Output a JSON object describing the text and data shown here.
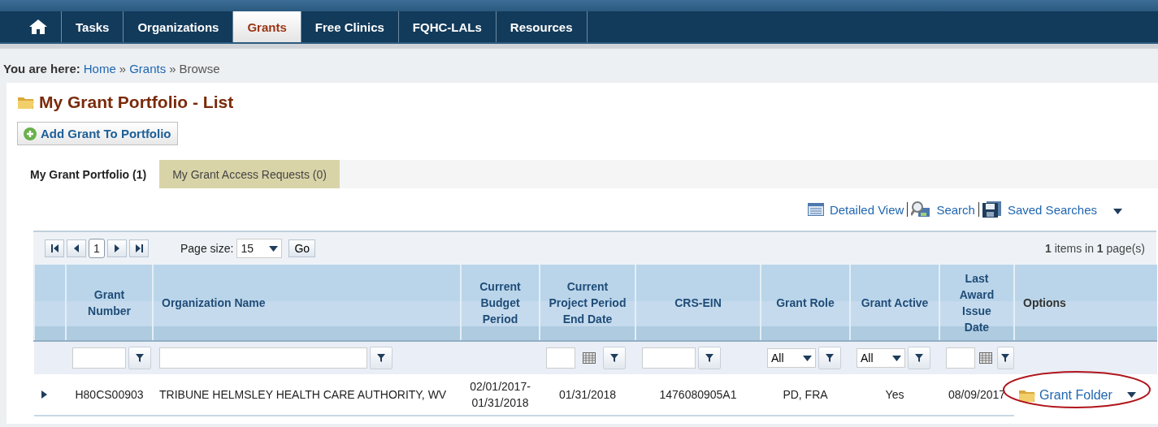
{
  "nav": [
    {
      "kind": "home",
      "selected": false
    },
    {
      "kind": "text",
      "label": "Tasks",
      "selected": false
    },
    {
      "kind": "text",
      "label": "Organizations",
      "selected": false
    },
    {
      "kind": "text",
      "label": "Grants",
      "selected": true
    },
    {
      "kind": "text",
      "label": "Free Clinics",
      "selected": false
    },
    {
      "kind": "text",
      "label": "FQHC-LALs",
      "selected": false
    },
    {
      "kind": "text",
      "label": "Resources",
      "selected": false
    }
  ],
  "breadcrumb": {
    "label": "You are here:",
    "links": [
      "Home",
      "Grants"
    ],
    "separators": [
      "»",
      "»"
    ],
    "current": "Browse"
  },
  "page_title": "My Grant Portfolio - List",
  "add_button": "Add Grant To Portfolio",
  "tabs": [
    {
      "label": "My Grant Portfolio (1)",
      "selected": true
    },
    {
      "label": "My Grant Access Requests (0)",
      "selected": false
    }
  ],
  "view_links": [
    {
      "kind": "list",
      "label": "Detailed View"
    },
    {
      "kind": "search",
      "label": "Search"
    },
    {
      "kind": "save",
      "label": "Saved Searches"
    }
  ],
  "pager": {
    "page": "1",
    "page_size_label": "Page size:",
    "page_size": "15",
    "go": "Go",
    "summary": "**1** items in **1** page(s)"
  },
  "columns": [
    {
      "filter": {
        "kind": "none"
      }
    },
    {
      "label": "Grant Number",
      "filter": {
        "kind": "text"
      }
    },
    {
      "label": "Organization Name",
      "filter": {
        "kind": "text"
      }
    },
    {
      "label": "Current Budget Period",
      "filter": {
        "kind": "none"
      }
    },
    {
      "label": "Current Project Period End Date",
      "filter": {
        "kind": "date"
      }
    },
    {
      "label": "CRS-EIN",
      "filter": {
        "kind": "text"
      }
    },
    {
      "label": "Grant Role",
      "filter": {
        "kind": "select",
        "value": "All"
      }
    },
    {
      "label": "Grant Active",
      "filter": {
        "kind": "select",
        "value": "All"
      }
    },
    {
      "label": "Last Award Issue Date",
      "filter": {
        "kind": "date"
      }
    },
    {
      "label": "Options",
      "filter": {
        "kind": "none"
      }
    }
  ],
  "rows": [
    {
      "expanded": false,
      "cells": [
        "H80CS00903",
        "TRIBUNE HELMSLEY HEALTH CARE AUTHORITY, WV",
        "02/01/2017-01/31/2018",
        "01/31/2018",
        "1476080905A1",
        "PD, FRA",
        "Yes",
        "08/09/2017"
      ],
      "option": "Grant Folder"
    }
  ]
}
